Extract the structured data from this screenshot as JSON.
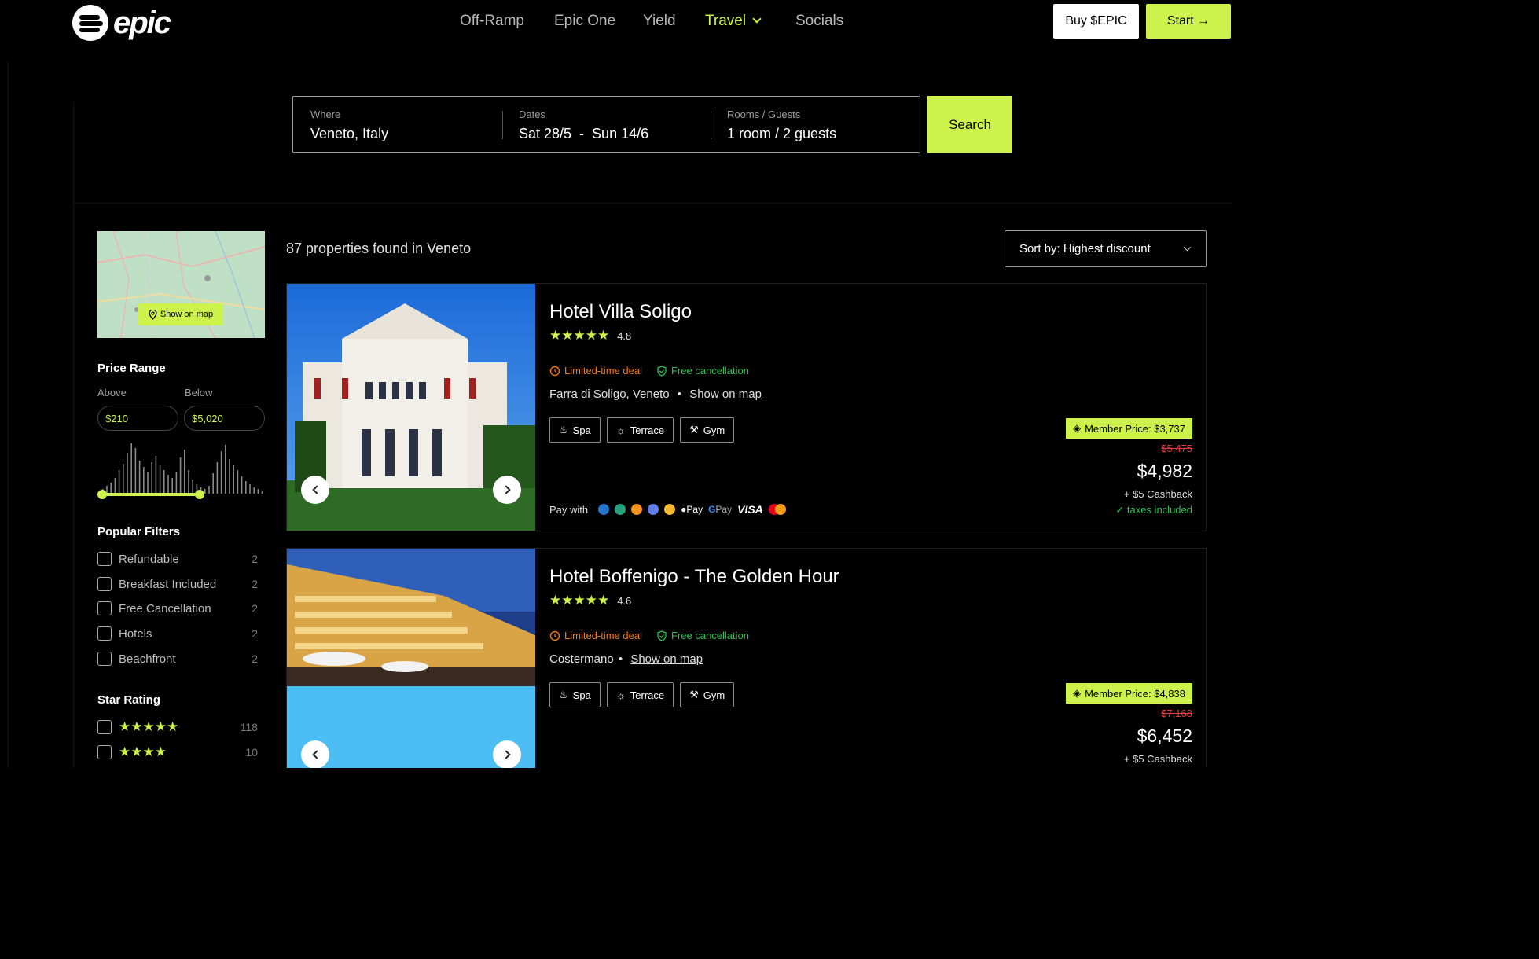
{
  "header": {
    "logo_text": "epic",
    "nav": [
      {
        "label": "Off-Ramp"
      },
      {
        "label": "Epic One"
      },
      {
        "label": "Yield"
      },
      {
        "label": "Travel"
      },
      {
        "label": "Socials"
      }
    ],
    "buy_label": "Buy $EPIC",
    "start_label": "Start →",
    "accent_color": "#cdf24b"
  },
  "search": {
    "where_label": "Where",
    "where_value": "Veneto, Italy",
    "dates_label": "Dates",
    "dates_value": "Sat 28/5  -  Sun 14/6",
    "rooms_label": "Rooms / Guests",
    "rooms_value": "1 room / 2 guests",
    "button_label": "Search"
  },
  "sidebar": {
    "map_button": "Show on map",
    "price_title": "Price Range",
    "above_label": "Above",
    "below_label": "Below",
    "above_value": "$210",
    "below_value": "$5,020",
    "popular_title": "Popular Filters",
    "popular": [
      {
        "label": "Refundable",
        "count": "2"
      },
      {
        "label": "Breakfast Included",
        "count": "2"
      },
      {
        "label": "Free Cancellation",
        "count": "2"
      },
      {
        "label": "Hotels",
        "count": "2"
      },
      {
        "label": "Beachfront",
        "count": "2"
      }
    ],
    "star_title": "Star Rating",
    "stars": [
      {
        "stars": "★★★★★",
        "count": "118"
      },
      {
        "stars": "★★★★",
        "count": "10"
      }
    ]
  },
  "results": {
    "count_text": "87 properties found in Veneto",
    "sort_label": "Sort by: Highest discount"
  },
  "hotels": [
    {
      "name": "Hotel Villa Soligo",
      "stars": "★★★★★",
      "rating": "4.8",
      "deal": "Limited-time deal",
      "cancel": "Free cancellation",
      "location": "Farra di Soligo, Veneto",
      "map_link": "Show on map",
      "amenities": [
        "Spa",
        "Terrace",
        "Gym"
      ],
      "pay_with": "Pay with",
      "member_price": "Member Price: $3,737",
      "old_price": "$5,475",
      "price": "$4,982",
      "cashback": "+ $5 Cashback",
      "taxes": "taxes included"
    },
    {
      "name": "Hotel Boffenigo - The Golden Hour",
      "stars": "★★★★★",
      "rating": "4.6",
      "deal": "Limited-time deal",
      "cancel": "Free cancellation",
      "location": "Costermano",
      "map_link": "Show on map",
      "amenities": [
        "Spa",
        "Terrace",
        "Gym"
      ],
      "member_price": "Member Price: $4,838",
      "old_price": "$7,168",
      "price": "$6,452",
      "cashback": "+ $5 Cashback"
    }
  ],
  "payment": {
    "apple_pay": "Pay",
    "google_pay": "Pay",
    "visa": "VISA"
  }
}
